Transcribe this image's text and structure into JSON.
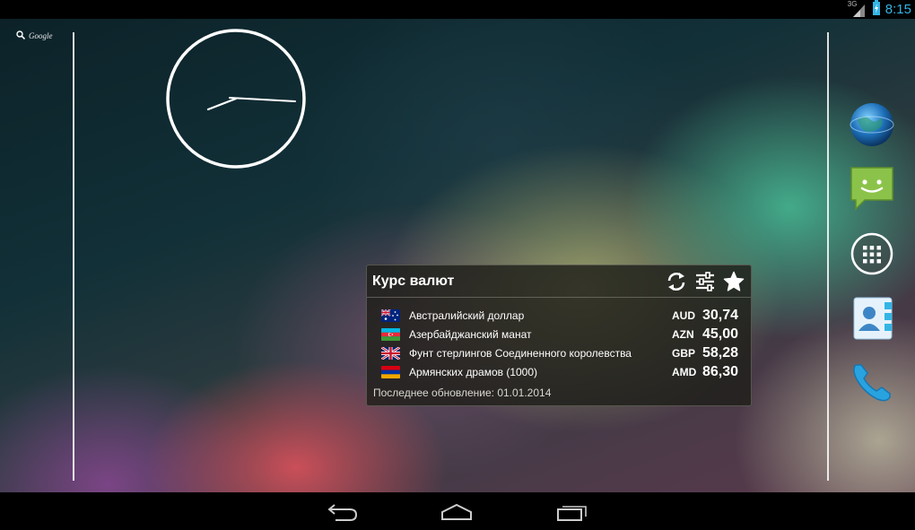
{
  "status_bar": {
    "network_label": "3G",
    "time": "8:15",
    "icons": [
      "signal-icon",
      "battery-charging-icon"
    ]
  },
  "home": {
    "google_search_label": "Google",
    "dock_apps": [
      {
        "name": "browser",
        "icon": "globe-icon"
      },
      {
        "name": "messaging",
        "icon": "sms-icon"
      },
      {
        "name": "all-apps",
        "icon": "app-drawer-icon"
      },
      {
        "name": "contacts",
        "icon": "contacts-icon"
      },
      {
        "name": "phone",
        "icon": "phone-icon"
      }
    ]
  },
  "widget": {
    "title": "Курс валют",
    "actions": [
      "refresh-icon",
      "settings-sliders-icon",
      "star-icon"
    ],
    "rates": [
      {
        "flag": "australia",
        "name": "Австралийский доллар",
        "code": "AUD",
        "value": "30,74"
      },
      {
        "flag": "azerbaijan",
        "name": "Азербайджанский манат",
        "code": "AZN",
        "value": "45,00"
      },
      {
        "flag": "united-kingdom",
        "name": "Фунт стерлингов Соединенного королевства",
        "code": "GBP",
        "value": "58,28"
      },
      {
        "flag": "armenia",
        "name": "Армянских драмов (1000)",
        "code": "AMD",
        "value": "86,30"
      }
    ],
    "last_update": "Последнее обновление: 01.01.2014"
  },
  "nav_bar": {
    "buttons": [
      "back-icon",
      "home-icon",
      "recent-apps-icon"
    ]
  },
  "colors": {
    "accent": "#33b5e5",
    "widget_bg": "#1e1e1a"
  }
}
